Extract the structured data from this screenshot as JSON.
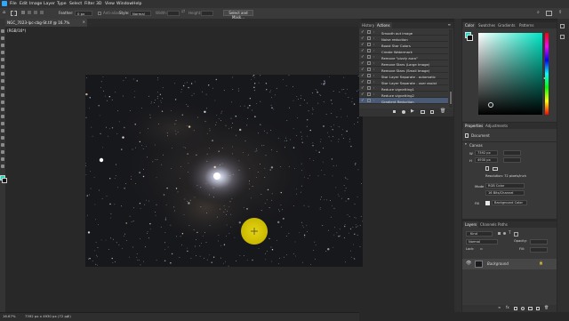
{
  "menu": [
    "File",
    "Edit",
    "Image",
    "Layer",
    "Type",
    "Select",
    "Filter",
    "3D",
    "View",
    "Window",
    "Help"
  ],
  "options": {
    "feather_label": "Feather:",
    "feather_value": "0 px",
    "antialias_label": "Anti-alias",
    "style_label": "Style:",
    "style_value": "Normal",
    "width_label": "Width:",
    "height_label": "Height:",
    "select_mask_button": "Select and Mask..."
  },
  "document": {
    "tab_title": "NGC_7023-lpc-cbg-St.tif @ 16.7% (RGB/16*)",
    "zoom": "16.67%",
    "dimensions": "7392 px x 4930 px (72 ppi)"
  },
  "actions_panel": {
    "tabs": [
      "History",
      "Actions"
    ],
    "items": [
      {
        "label": "Smooth out image",
        "selected": false
      },
      {
        "label": "Noise reduction",
        "selected": false
      },
      {
        "label": "Boost Star Colors",
        "selected": false
      },
      {
        "label": "Create Watermark",
        "selected": false
      },
      {
        "label": "Remove \"pizzly aura\"",
        "selected": false
      },
      {
        "label": "Remove Stars (Large Image)",
        "selected": false
      },
      {
        "label": "Remove Stars (Small Image)",
        "selected": false
      },
      {
        "label": "Star Layer Separate - automatic",
        "selected": false
      },
      {
        "label": "Star Layer Separate - user assist",
        "selected": false
      },
      {
        "label": "Reduce vignetting1",
        "selected": false
      },
      {
        "label": "Reduce vignetting2",
        "selected": false
      },
      {
        "label": "Gradient Reduction",
        "selected": true
      }
    ]
  },
  "color_panel": {
    "tabs": [
      "Color",
      "Swatches",
      "Gradients",
      "Patterns"
    ],
    "hue_color": "#00e5c4"
  },
  "properties_panel": {
    "tabs": [
      "Properties",
      "Adjustments"
    ],
    "type_label": "Document",
    "section": "Canvas",
    "width_label": "W",
    "width_value": "7392 px",
    "height_label": "H",
    "height_value": "4930 px",
    "resolution": "Resolution: 72 pixels/inch",
    "mode_label": "Mode",
    "mode_value": "RGB Color",
    "depth_value": "16 Bits/Channel",
    "fill_label": "Fill",
    "fill_value": "Background Color"
  },
  "layers_panel": {
    "tabs": [
      "Layers",
      "Channels",
      "Paths"
    ],
    "kind_label": "Kind",
    "blend_mode": "Normal",
    "opacity_label": "Opacity:",
    "lock_label": "Lock:",
    "fill_label": "Fill:",
    "layer_name": "Background"
  }
}
